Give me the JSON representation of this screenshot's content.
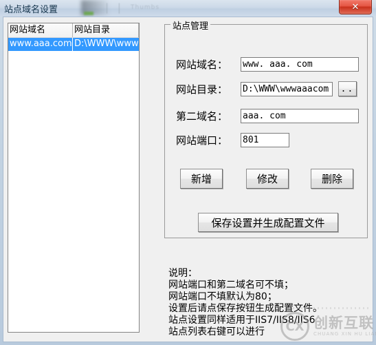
{
  "window": {
    "title": "站点域名设置",
    "title_ghost_1": "| |",
    "title_ghost_2": "Thumbs",
    "close_label": "✕"
  },
  "listview": {
    "columns": [
      "网站域名",
      "网站目录"
    ],
    "rows": [
      {
        "domain": "www.aaa.com",
        "directory": "D:\\WWW\\wwwa"
      }
    ]
  },
  "groupbox": {
    "title": "站点管理",
    "fields": [
      {
        "label": "网站域名：",
        "value": "www. aaa. com",
        "placeholder": ""
      },
      {
        "label": "网站目录：",
        "value": "D:\\WWW\\wwwaaacom",
        "placeholder": ""
      },
      {
        "label": "第二域名：",
        "value": "aaa. com",
        "placeholder": ""
      },
      {
        "label": "网站端口：",
        "value": "801",
        "placeholder": ""
      }
    ],
    "browse_label": "..",
    "buttons": {
      "add": "新增",
      "edit": "修改",
      "delete": "删除",
      "save": "保存设置并生成配置文件"
    }
  },
  "notes": {
    "lines": [
      "说明：",
      "网站端口和第二域名可不填；",
      "网站端口不填默认为80；",
      "设置后请点保存按钮生成配置文件。",
      "站点设置同样适用于IIS7/IIS8/IIS6",
      "站点列表右键可以进行"
    ]
  },
  "watermark": {
    "logo": "CX",
    "main": "创新互联",
    "sub": "CHUANG XIN HU LIAN"
  }
}
